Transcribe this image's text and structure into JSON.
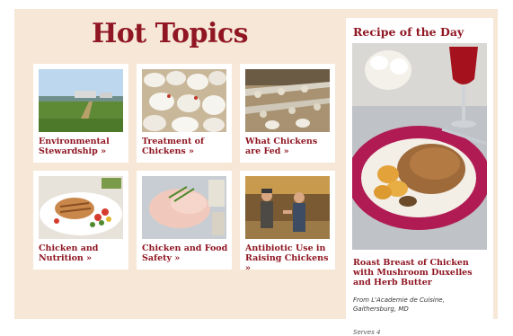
{
  "hot_topics": {
    "heading": "Hot Topics",
    "cards": [
      {
        "label": "Environmental Stewardship »",
        "image": "farm-field-image"
      },
      {
        "label": "Treatment of Chickens »",
        "image": "chickens-barn-image"
      },
      {
        "label": "What Chickens are Fed »",
        "image": "feeding-line-image"
      },
      {
        "label": "Chicken and Nutrition »",
        "image": "grilled-chicken-plate-image"
      },
      {
        "label": "Chicken and Food Safety »",
        "image": "raw-chicken-image"
      },
      {
        "label": "Antibiotic Use in Raising Chickens »",
        "image": "farmers-talking-image"
      }
    ]
  },
  "recipe": {
    "heading": "Recipe of the Day",
    "name": "Roast Breast of Chicken with Mushroom Duxelles and Herb Butter",
    "source": "From L'Academie de Cuisine, Gaithersburg, MD",
    "serves": "Serves 4",
    "image": "roast-chicken-dish-image"
  },
  "colors": {
    "accent": "#8f1622",
    "background": "#f6e7d6"
  }
}
